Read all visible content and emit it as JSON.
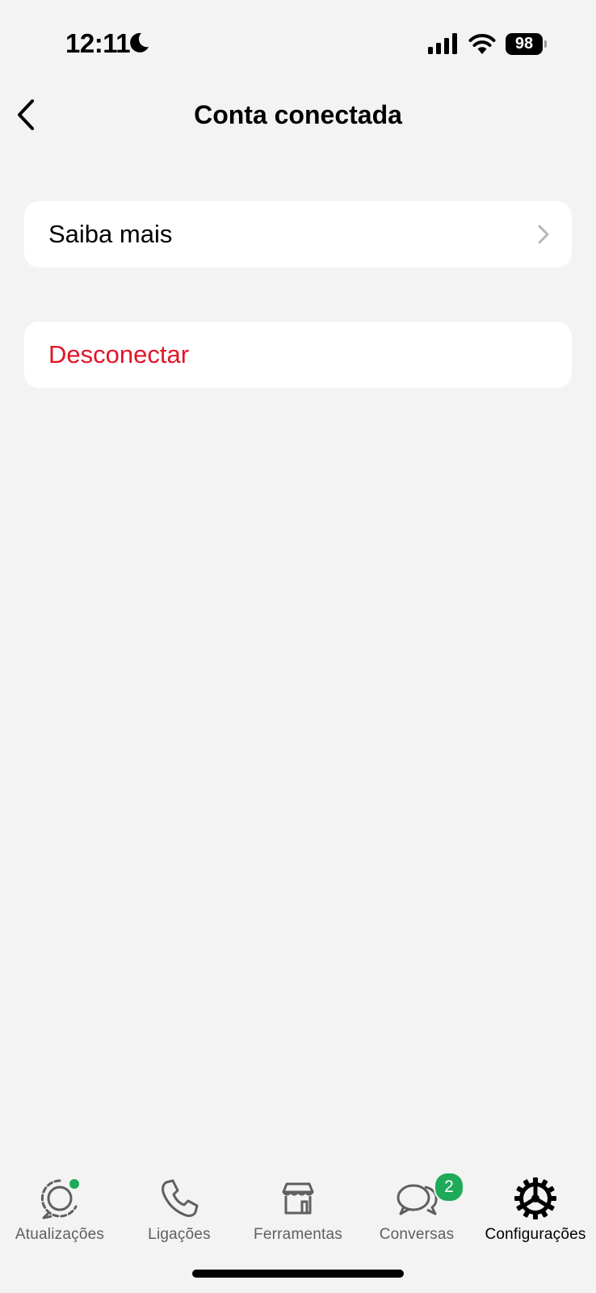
{
  "status_bar": {
    "time": "12:11",
    "battery_level": "98",
    "icons": [
      "moon-icon",
      "signal-icon",
      "wifi-icon",
      "battery-icon"
    ]
  },
  "header": {
    "title": "Conta conectada",
    "back_icon": "chevron-left-icon"
  },
  "items": {
    "learn_more": "Saiba mais",
    "disconnect": "Desconectar"
  },
  "colors": {
    "background": "#f3f3f3",
    "destructive": "#e2152b",
    "badge": "#1faa59",
    "tab_inactive": "#5f5f5f",
    "tab_active": "#000000"
  },
  "tab_bar": {
    "tabs": [
      {
        "label": "Atualizações",
        "icon": "status-icon",
        "dot": true
      },
      {
        "label": "Ligações",
        "icon": "phone-icon"
      },
      {
        "label": "Ferramentas",
        "icon": "store-icon"
      },
      {
        "label": "Conversas",
        "icon": "chat-bubbles-icon",
        "badge": "2"
      },
      {
        "label": "Configurações",
        "icon": "settings-gear-icon",
        "active": true
      }
    ]
  }
}
